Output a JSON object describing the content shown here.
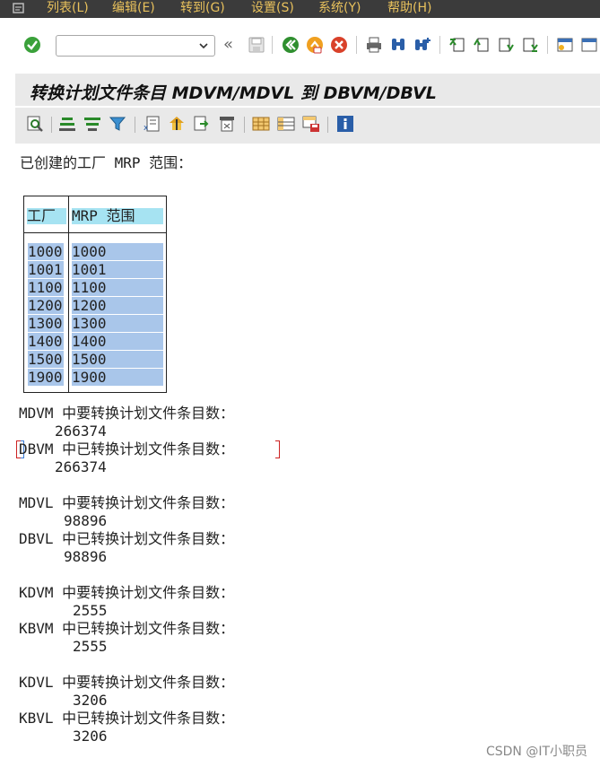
{
  "menu": {
    "items": [
      "列表(L)",
      "编辑(E)",
      "转到(G)",
      "设置(S)",
      "系统(Y)",
      "帮助(H)"
    ]
  },
  "toolbar": {
    "command_field": {
      "value": "",
      "placeholder": ""
    },
    "nav_back_glyph": "«"
  },
  "title": "转换计划文件条目 MDVM/MDVL 到 DBVM/DBVL",
  "list": {
    "heading": "已创建的工厂 MRP 范围：",
    "table": {
      "columns": [
        "工厂",
        "MRP 范围"
      ],
      "rows": [
        [
          "1000",
          "1000"
        ],
        [
          "1001",
          "1001"
        ],
        [
          "1100",
          "1100"
        ],
        [
          "1200",
          "1200"
        ],
        [
          "1300",
          "1300"
        ],
        [
          "1400",
          "1400"
        ],
        [
          "1500",
          "1500"
        ],
        [
          "1900",
          "1900"
        ]
      ]
    },
    "counts": [
      {
        "label": "MDVM 中要转换计划文件条目数：",
        "value": "266374"
      },
      {
        "label": "DBVM 中已转换计划文件条目数：",
        "value": "266374"
      },
      {
        "label": "MDVL 中要转换计划文件条目数：",
        "value": "98896"
      },
      {
        "label": "DBVL 中已转换计划文件条目数：",
        "value": "98896"
      },
      {
        "label": "KDVM 中要转换计划文件条目数：",
        "value": "2555"
      },
      {
        "label": "KBVM 中已转换计划文件条目数：",
        "value": "2555"
      },
      {
        "label": "KDVL 中要转换计划文件条目数：",
        "value": "3206"
      },
      {
        "label": "KBVL 中已转换计划文件条目数：",
        "value": "3206"
      }
    ]
  },
  "watermark": "CSDN @IT小职员",
  "colors": {
    "menubar_bg": "#3b3b3b",
    "menu_text": "#e8c15c",
    "title_bg": "#e9e9e9",
    "table_header_bg": "#a6e3f2",
    "table_cell_bg": "#a9c6ea"
  }
}
